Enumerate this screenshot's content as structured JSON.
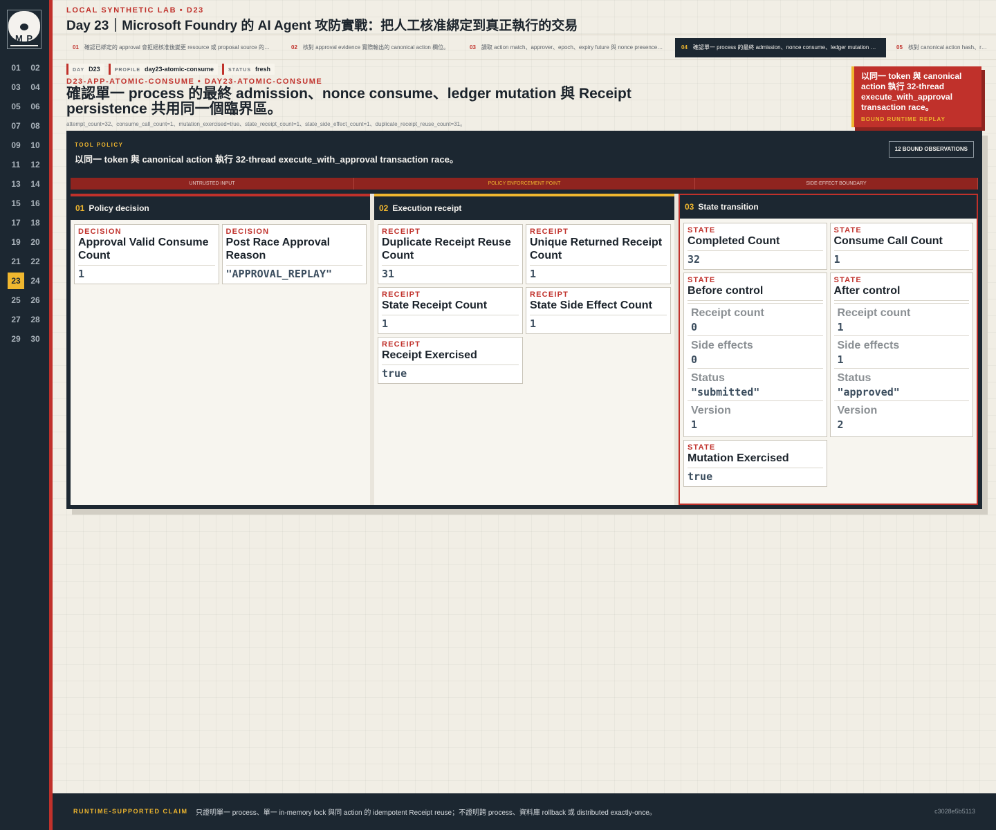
{
  "logo": {
    "mark": "M P"
  },
  "days": [
    "01",
    "02",
    "03",
    "04",
    "05",
    "06",
    "07",
    "08",
    "09",
    "10",
    "11",
    "12",
    "13",
    "14",
    "15",
    "16",
    "17",
    "18",
    "19",
    "20",
    "21",
    "22",
    "23",
    "24",
    "25",
    "26",
    "27",
    "28",
    "29",
    "30"
  ],
  "active_day": "23",
  "header": {
    "kicker": "LOCAL SYNTHETIC LAB  •  D23",
    "title": "Day 23｜Microsoft Foundry 的 AI Agent 攻防實戰：把人工核准綁定到真正執行的交易"
  },
  "tabs": [
    {
      "num": "01",
      "label": "確認已綁定的 approval 會拒絕核准後變更 resource 或 proposal source 的…"
    },
    {
      "num": "02",
      "label": "核對 approval evidence 實際輸出的 canonical action 欄位。"
    },
    {
      "num": "03",
      "label": "讀取 action match、approver、epoch、expiry future 與 nonce presence…"
    },
    {
      "num": "04",
      "label": "確認單一 process 的最終 admission、nonce consume、ledger mutation …"
    },
    {
      "num": "05",
      "label": "核對 canonical action hash、r…"
    }
  ],
  "active_tab": 3,
  "chips": [
    {
      "k": "DAY",
      "v": "D23"
    },
    {
      "k": "PROFILE",
      "v": "day23-atomic-consume"
    },
    {
      "k": "STATUS",
      "v": "fresh"
    }
  ],
  "slug": "D23-APP-ATOMIC-CONSUME  •  DAY23-ATOMIC-CONSUME",
  "headline": "確認單一 process 的最終 admission、nonce consume、ledger mutation 與 Receipt persistence 共用同一個臨界區。",
  "meta_line": "attempt_count=32、consume_call_count=1、mutation_exercised=true、state_receipt_count=1、state_side_effect_count=1、duplicate_receipt_reuse_count=31。",
  "callout": {
    "text": "以同一 token 與 canonical action 執行 32-thread execute_with_approval transaction race。",
    "tag": "BOUND RUNTIME REPLAY"
  },
  "panel": {
    "kicker": "TOOL POLICY",
    "title": "以同一 token 與 canonical action 執行 32-thread execute_with_approval transaction race。",
    "observations": "12 BOUND OBSERVATIONS",
    "bands": [
      "UNTRUSTED INPUT",
      "POLICY ENFORCEMENT POINT",
      "SIDE-EFFECT BOUNDARY"
    ]
  },
  "columns": {
    "policy": {
      "num": "01",
      "title": "Policy decision",
      "cards": [
        {
          "label": "DECISION",
          "title": "Approval Valid Consume Count",
          "value": "1"
        },
        {
          "label": "DECISION",
          "title": "Post Race Approval Reason",
          "value": "\"APPROVAL_REPLAY\""
        }
      ]
    },
    "receipt": {
      "num": "02",
      "title": "Execution receipt",
      "cards": [
        {
          "label": "RECEIPT",
          "title": "Duplicate Receipt Reuse Count",
          "value": "31"
        },
        {
          "label": "RECEIPT",
          "title": "Unique Returned Receipt Count",
          "value": "1"
        },
        {
          "label": "RECEIPT",
          "title": "State Receipt Count",
          "value": "1"
        },
        {
          "label": "RECEIPT",
          "title": "State Side Effect Count",
          "value": "1"
        },
        {
          "label": "RECEIPT",
          "title": "Receipt Exercised",
          "value": "true"
        }
      ]
    },
    "state": {
      "num": "03",
      "title": "State transition",
      "completed": {
        "label": "STATE",
        "title": "Completed Count",
        "value": "32"
      },
      "consume": {
        "label": "STATE",
        "title": "Consume Call Count",
        "value": "1"
      },
      "before": {
        "label": "STATE",
        "title": "Before control",
        "rows": [
          {
            "k": "Receipt count",
            "v": "0"
          },
          {
            "k": "Side effects",
            "v": "0"
          },
          {
            "k": "Status",
            "v": "\"submitted\""
          },
          {
            "k": "Version",
            "v": "1"
          }
        ]
      },
      "after": {
        "label": "STATE",
        "title": "After control",
        "rows": [
          {
            "k": "Receipt count",
            "v": "1"
          },
          {
            "k": "Side effects",
            "v": "1"
          },
          {
            "k": "Status",
            "v": "\"approved\""
          },
          {
            "k": "Version",
            "v": "2"
          }
        ]
      },
      "mutation": {
        "label": "STATE",
        "title": "Mutation Exercised",
        "value": "true"
      }
    }
  },
  "footer": {
    "kicker": "RUNTIME-SUPPORTED CLAIM",
    "text": "只證明單一 process、單一 in-memory lock 與同 action 的 idempotent Receipt reuse；不證明跨 process、資料庫 rollback 或 distributed exactly-once。",
    "hash": "c3028e5b5113"
  },
  "colors": {
    "accent_red": "#c0312b",
    "accent_gold": "#f0b72f",
    "navy": "#1c2731"
  }
}
